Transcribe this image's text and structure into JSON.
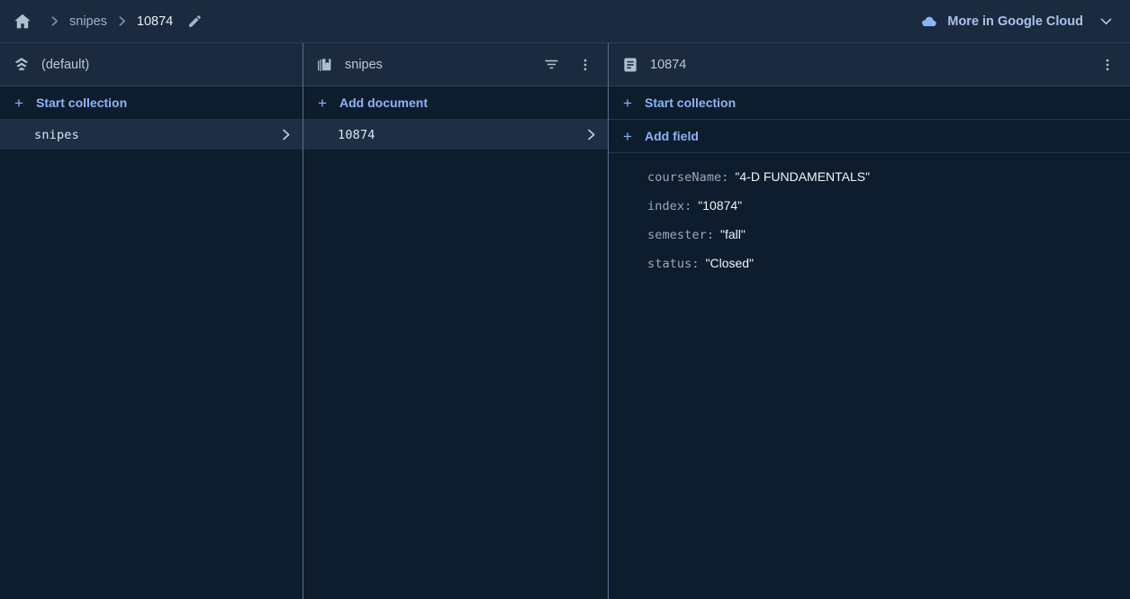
{
  "topbar": {
    "home_icon": "home-icon",
    "separator": "chevron-right-icon",
    "breadcrumb": [
      {
        "label": "snipes",
        "current": false
      },
      {
        "label": "10874",
        "current": true
      }
    ],
    "edit_icon": "pencil-icon",
    "more_in_cloud": {
      "icon": "google-cloud-icon",
      "label": "More in Google Cloud",
      "chevron": "chevron-down-icon"
    }
  },
  "panels": {
    "database": {
      "icon": "firestore-icon",
      "title": "(default)",
      "action": {
        "plus": "+",
        "label": "Start collection"
      },
      "rows": [
        {
          "label": "snipes",
          "selected": true,
          "chevron": "chevron-right-icon"
        }
      ]
    },
    "collection": {
      "icon": "collection-icon",
      "title": "snipes",
      "filter_icon": "filter-icon",
      "menu_icon": "more-vert-icon",
      "action": {
        "plus": "+",
        "label": "Add document"
      },
      "rows": [
        {
          "label": "10874",
          "selected": true,
          "chevron": "chevron-right-icon"
        }
      ]
    },
    "document": {
      "icon": "document-icon",
      "title": "10874",
      "menu_icon": "more-vert-icon",
      "actions": [
        {
          "plus": "+",
          "label": "Start collection"
        },
        {
          "plus": "+",
          "label": "Add field"
        }
      ],
      "fields": [
        {
          "key": "courseName",
          "colon": ":",
          "value": "\"4-D FUNDAMENTALS\""
        },
        {
          "key": "index",
          "colon": ":",
          "value": "\"10874\""
        },
        {
          "key": "semester",
          "colon": ":",
          "value": "\"fall\""
        },
        {
          "key": "status",
          "colon": ":",
          "value": "\"Closed\""
        }
      ]
    }
  },
  "colors": {
    "bar_background": "#1b2a3e",
    "panel_background": "#0e1d2d",
    "selected_row": "#1e2f45",
    "accent_link": "#8ab4f8",
    "divider": "#56718f"
  }
}
